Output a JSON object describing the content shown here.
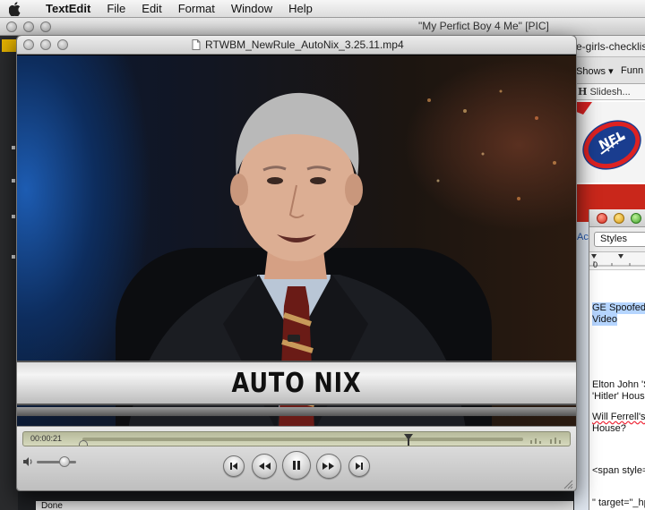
{
  "menubar": {
    "app_name": "TextEdit",
    "items": [
      "File",
      "Edit",
      "Format",
      "Window",
      "Help"
    ]
  },
  "background_window": {
    "title": "\"My Perfict Boy 4 Me\" [PIC]"
  },
  "browser": {
    "url_fragment": "e-girls-checklis",
    "tabs": [
      "Shows ▾",
      "Funn"
    ],
    "slideshow_label": "Slidesh...",
    "image_text": "NFL",
    "ac_fragment": "Ac"
  },
  "doc": {
    "styles_label": "Styles",
    "ruler_zero": "0",
    "lines": [
      "GE Spoofed.",
      "Video",
      "Elton John 'S",
      "'Hitler' House",
      "Will Ferrell's",
      "House?",
      "<span style=",
      "\" target=\"_hp"
    ]
  },
  "status_bar": {
    "text": "Done"
  },
  "quicktime": {
    "title": "RTWBM_NewRule_AutoNix_3.25.11.mp4",
    "chyron": "AUTO NIX",
    "time": "00:00:21",
    "playhead_fraction": 0.74,
    "volume_fraction": 0.7,
    "buttons": [
      "go-to-start",
      "rewind",
      "pause",
      "fast-forward",
      "go-to-end"
    ]
  }
}
